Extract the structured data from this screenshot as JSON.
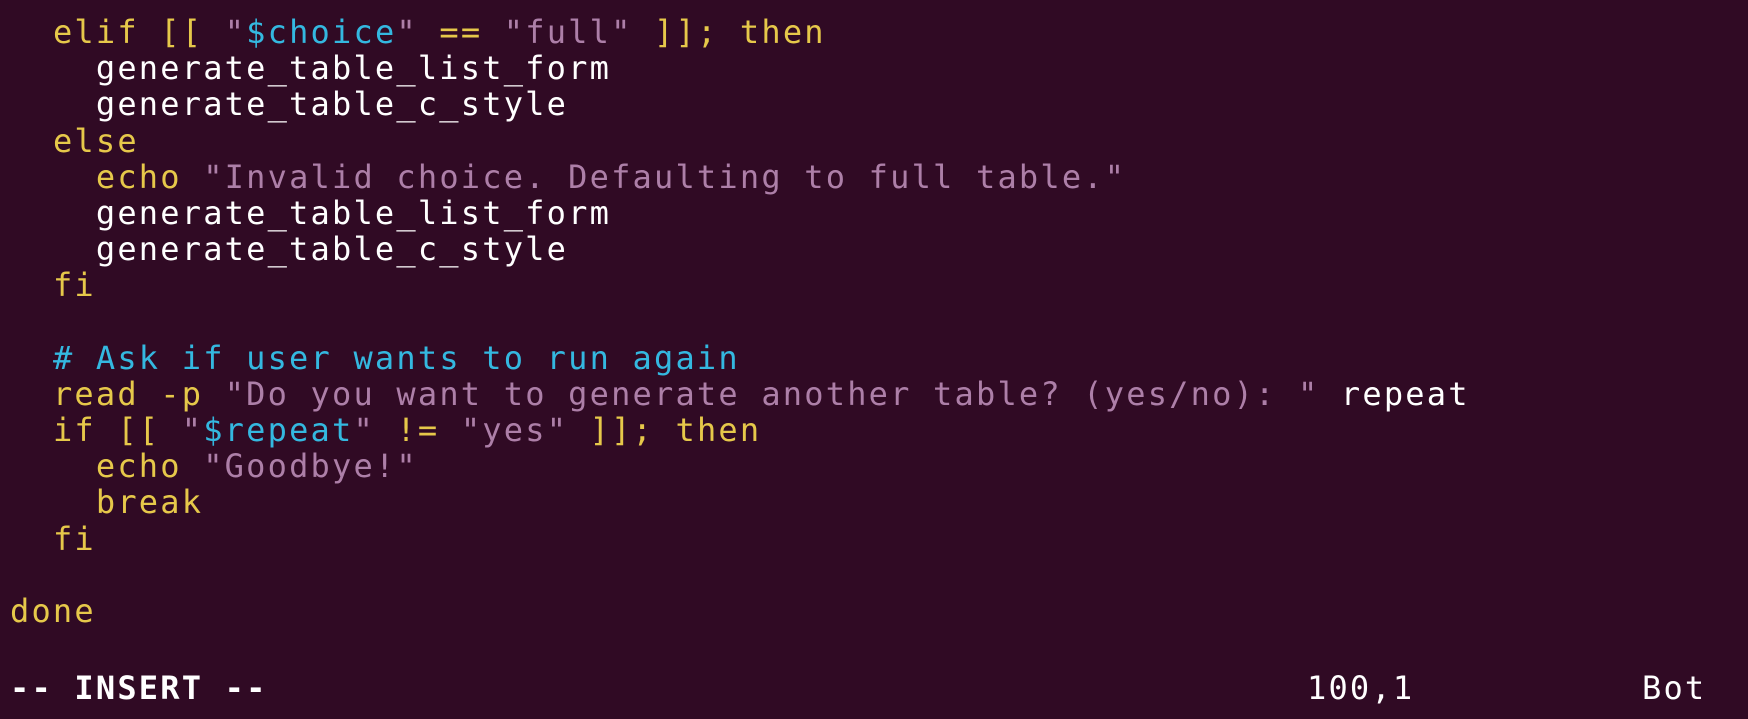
{
  "colors": {
    "background": "#300a24",
    "keyword": "#e6c84a",
    "string": "#ad7fa8",
    "variable": "#34b8e0",
    "comment": "#34b8e0",
    "plain": "#ffffff"
  },
  "editor": {
    "lines": [
      [
        {
          "t": "  ",
          "c": "plain"
        },
        {
          "t": "elif",
          "c": "kw"
        },
        {
          "t": " [[ ",
          "c": "op"
        },
        {
          "t": "\"",
          "c": "str"
        },
        {
          "t": "$choice",
          "c": "var"
        },
        {
          "t": "\"",
          "c": "str"
        },
        {
          "t": " == ",
          "c": "op"
        },
        {
          "t": "\"full\"",
          "c": "str"
        },
        {
          "t": " ]]; ",
          "c": "op"
        },
        {
          "t": "then",
          "c": "kw"
        }
      ],
      [
        {
          "t": "    generate_table_list_form",
          "c": "plain"
        }
      ],
      [
        {
          "t": "    generate_table_c_style",
          "c": "plain"
        }
      ],
      [
        {
          "t": "  ",
          "c": "plain"
        },
        {
          "t": "else",
          "c": "kw"
        }
      ],
      [
        {
          "t": "    ",
          "c": "plain"
        },
        {
          "t": "echo",
          "c": "kw"
        },
        {
          "t": " ",
          "c": "plain"
        },
        {
          "t": "\"Invalid choice. Defaulting to full table.\"",
          "c": "str"
        }
      ],
      [
        {
          "t": "    generate_table_list_form",
          "c": "plain"
        }
      ],
      [
        {
          "t": "    generate_table_c_style",
          "c": "plain"
        }
      ],
      [
        {
          "t": "  ",
          "c": "plain"
        },
        {
          "t": "fi",
          "c": "kw"
        }
      ],
      [
        {
          "t": "",
          "c": "plain"
        }
      ],
      [
        {
          "t": "  ",
          "c": "plain"
        },
        {
          "t": "# Ask if user wants to run again",
          "c": "com"
        }
      ],
      [
        {
          "t": "  ",
          "c": "plain"
        },
        {
          "t": "read",
          "c": "kw"
        },
        {
          "t": " -p ",
          "c": "kw"
        },
        {
          "t": "\"Do you want to generate another table? (yes/no): \"",
          "c": "str"
        },
        {
          "t": " repeat",
          "c": "plain"
        }
      ],
      [
        {
          "t": "  ",
          "c": "plain"
        },
        {
          "t": "if",
          "c": "kw"
        },
        {
          "t": " [[ ",
          "c": "op"
        },
        {
          "t": "\"",
          "c": "str"
        },
        {
          "t": "$repeat",
          "c": "var"
        },
        {
          "t": "\"",
          "c": "str"
        },
        {
          "t": " != ",
          "c": "op"
        },
        {
          "t": "\"yes\"",
          "c": "str"
        },
        {
          "t": " ]]; ",
          "c": "op"
        },
        {
          "t": "then",
          "c": "kw"
        }
      ],
      [
        {
          "t": "    ",
          "c": "plain"
        },
        {
          "t": "echo",
          "c": "kw"
        },
        {
          "t": " ",
          "c": "plain"
        },
        {
          "t": "\"Goodbye!\"",
          "c": "str"
        }
      ],
      [
        {
          "t": "    ",
          "c": "plain"
        },
        {
          "t": "break",
          "c": "kw"
        }
      ],
      [
        {
          "t": "  ",
          "c": "plain"
        },
        {
          "t": "fi",
          "c": "kw"
        }
      ],
      [
        {
          "t": "",
          "c": "plain"
        }
      ],
      [
        {
          "t": "done",
          "c": "kw"
        }
      ]
    ]
  },
  "statusbar": {
    "mode": "-- INSERT --",
    "cursor_position": "100,1",
    "scroll_position": "Bot"
  }
}
